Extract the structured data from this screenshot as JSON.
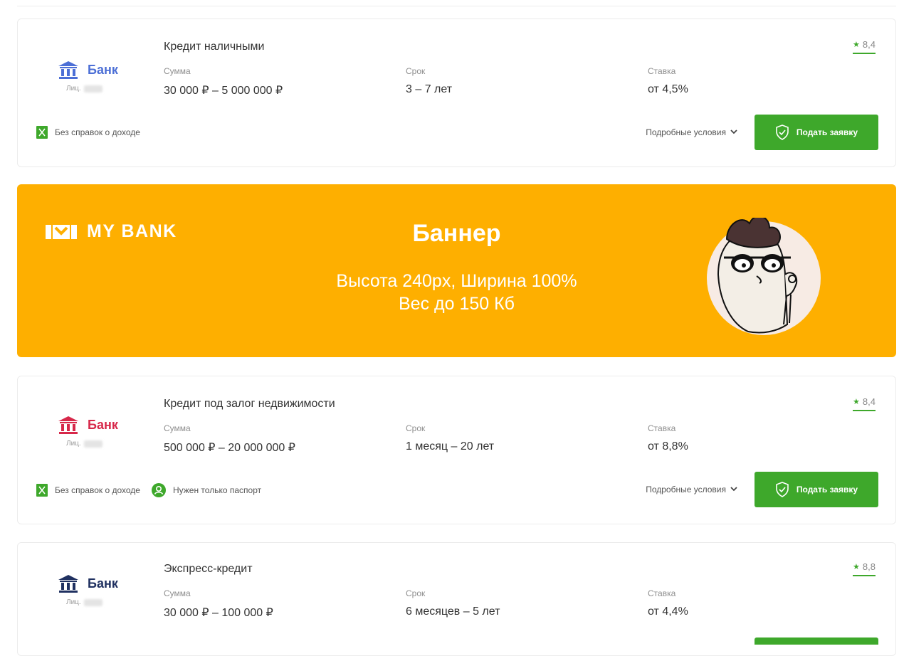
{
  "colors": {
    "accent_green": "#3ea82b",
    "banner_bg": "#feaf00",
    "bank_blue": "#4c6fd6",
    "bank_red": "#d7284a",
    "bank_navy": "#1f3060"
  },
  "products": [
    {
      "bank": {
        "name": "Банк",
        "license": "Лиц.",
        "color": "#4c6fd6",
        "icon": "bank-building-icon"
      },
      "title": "Кредит наличными",
      "sum": {
        "label": "Сумма",
        "value": "30 000 ₽ – 5 000 000 ₽"
      },
      "term": {
        "label": "Срок",
        "value": "3 – 7 лет"
      },
      "rate": {
        "label": "Ставка",
        "value": "от 4,5%"
      },
      "rating": "8,4",
      "features": [
        "Без справок о доходе"
      ],
      "details": "Подробные условия",
      "apply": "Подать заявку"
    },
    {
      "bank": {
        "name": "Банк",
        "license": "Лиц.",
        "color": "#d7284a",
        "icon": "bank-building-icon"
      },
      "title": "Кредит под залог недвижимости",
      "sum": {
        "label": "Сумма",
        "value": "500 000 ₽ – 20 000 000 ₽"
      },
      "term": {
        "label": "Срок",
        "value": "1 месяц – 20 лет"
      },
      "rate": {
        "label": "Ставка",
        "value": "от 8,8%"
      },
      "rating": "8,4",
      "features": [
        "Без справок о доходе",
        "Нужен только паспорт"
      ],
      "details": "Подробные условия",
      "apply": "Подать заявку"
    },
    {
      "bank": {
        "name": "Банк",
        "license": "Лиц.",
        "color": "#1f3060",
        "icon": "bank-building-icon"
      },
      "title": "Экспресс-кредит",
      "sum": {
        "label": "Сумма",
        "value": "30 000 ₽ – 100 000 ₽"
      },
      "term": {
        "label": "Срок",
        "value": "6 месяцев – 5 лет"
      },
      "rate": {
        "label": "Ставка",
        "value": "от 4,4%"
      },
      "rating": "8,8"
    }
  ],
  "banner": {
    "brand": "MY BANK",
    "title": "Баннер",
    "line1": "Высота 240px, Ширина 100%",
    "line2": "Вес до 150 Кб"
  }
}
